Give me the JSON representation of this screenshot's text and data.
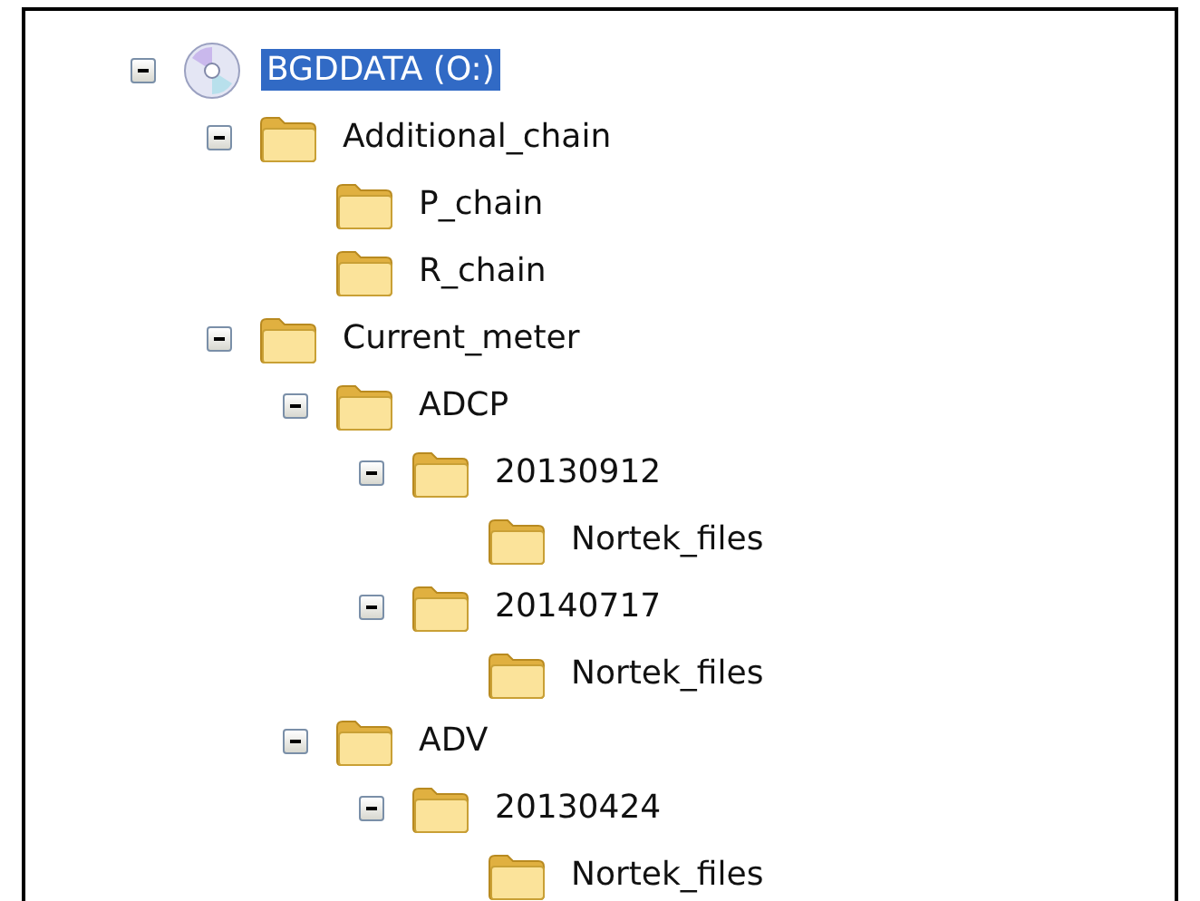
{
  "tree": [
    {
      "kind": "drive",
      "label": "BGDDATA (O:)",
      "selected": true,
      "expanded": true,
      "children": [
        {
          "kind": "folder",
          "label": "Additional_chain",
          "selected": false,
          "expanded": true,
          "children": [
            {
              "kind": "folder",
              "label": "P_chain",
              "selected": false
            },
            {
              "kind": "folder",
              "label": "R_chain",
              "selected": false
            }
          ]
        },
        {
          "kind": "folder",
          "label": "Current_meter",
          "selected": false,
          "expanded": true,
          "children": [
            {
              "kind": "folder",
              "label": "ADCP",
              "selected": false,
              "expanded": true,
              "children": [
                {
                  "kind": "folder",
                  "label": "20130912",
                  "selected": false,
                  "expanded": true,
                  "children": [
                    {
                      "kind": "folder",
                      "label": "Nortek_files",
                      "selected": false
                    }
                  ]
                },
                {
                  "kind": "folder",
                  "label": "20140717",
                  "selected": false,
                  "expanded": true,
                  "children": [
                    {
                      "kind": "folder",
                      "label": "Nortek_files",
                      "selected": false
                    }
                  ]
                }
              ]
            },
            {
              "kind": "folder",
              "label": "ADV",
              "selected": false,
              "expanded": true,
              "children": [
                {
                  "kind": "folder",
                  "label": "20130424",
                  "selected": false,
                  "expanded": true,
                  "children": [
                    {
                      "kind": "folder",
                      "label": "Nortek_files",
                      "selected": false
                    }
                  ]
                }
              ]
            }
          ]
        }
      ]
    }
  ]
}
